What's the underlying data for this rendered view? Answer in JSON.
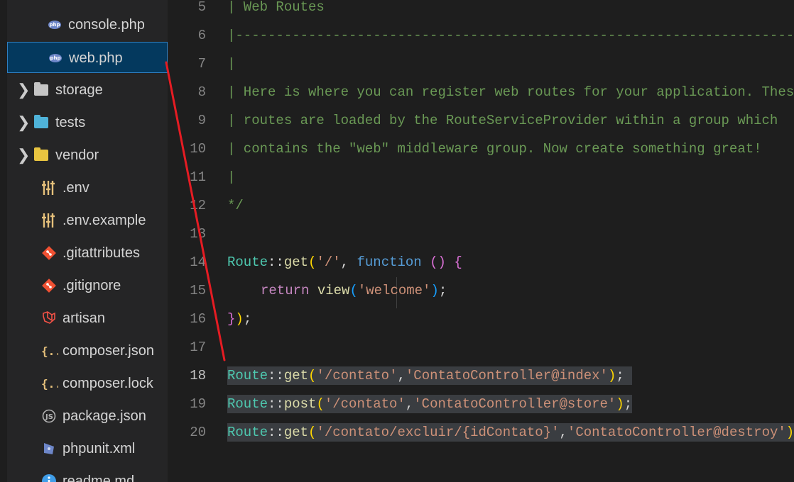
{
  "explorer": {
    "items": [
      {
        "label": "console.php",
        "icon": "php-icon",
        "type": "file"
      },
      {
        "label": "web.php",
        "icon": "php-icon",
        "type": "file",
        "selected": true
      },
      {
        "label": "storage",
        "icon": "folder-icon",
        "type": "folder",
        "chevron": "❯"
      },
      {
        "label": "tests",
        "icon": "folder-tests-icon",
        "type": "folder",
        "chevron": "❯"
      },
      {
        "label": "vendor",
        "icon": "folder-vendor-icon",
        "type": "folder",
        "chevron": "❯"
      },
      {
        "label": ".env",
        "icon": "settings-sliders-icon",
        "type": "file"
      },
      {
        "label": ".env.example",
        "icon": "settings-sliders-icon",
        "type": "file"
      },
      {
        "label": ".gitattributes",
        "icon": "git-icon",
        "type": "file"
      },
      {
        "label": ".gitignore",
        "icon": "git-icon",
        "type": "file"
      },
      {
        "label": "artisan",
        "icon": "laravel-icon",
        "type": "file"
      },
      {
        "label": "composer.json",
        "icon": "json-braces-icon",
        "type": "file"
      },
      {
        "label": "composer.lock",
        "icon": "json-braces-icon",
        "type": "file"
      },
      {
        "label": "package.json",
        "icon": "node-js-icon",
        "type": "file"
      },
      {
        "label": "phpunit.xml",
        "icon": "phpunit-icon",
        "type": "file"
      },
      {
        "label": "readme.md",
        "icon": "info-icon",
        "type": "file"
      }
    ]
  },
  "editor": {
    "line_numbers": [
      "5",
      "6",
      "7",
      "8",
      "9",
      "10",
      "11",
      "12",
      "13",
      "14",
      "15",
      "16",
      "17",
      "18",
      "19",
      "20"
    ],
    "active_line": "18",
    "lines": {
      "l5": "| Web Routes",
      "l6": "|--------------------------------------------------------------------------",
      "l7": "|",
      "l8": "| Here is where you can register web routes for your application. These",
      "l9": "| routes are loaded by the RouteServiceProvider within a group which",
      "l10": "| contains the \"web\" middleware group. Now create something great!",
      "l11": "|",
      "l12": "*/",
      "l14": {
        "cls": "Route",
        "sep": "::",
        "fn": "get",
        "lp": "(",
        "str": "'/'",
        "comma": ", ",
        "kw": "function",
        "sp": " ",
        "lp2": "(",
        "rp2": ")",
        "sp2": " ",
        "lb": "{"
      },
      "l15": {
        "kw": "return",
        "sp": " ",
        "fn": "view",
        "lp": "(",
        "str": "'welcome'",
        "rp": ")",
        "semi": ";"
      },
      "l16": {
        "rb": "}",
        "rp": ")",
        "semi": ";"
      },
      "l18": {
        "cls": "Route",
        "sep": "::",
        "fn": "get",
        "lp": "(",
        "str1": "'/contato'",
        "comma": ",",
        "str2": "'ContatoController@index'",
        "rp": ")",
        "semi": ";"
      },
      "l19": {
        "cls": "Route",
        "sep": "::",
        "fn": "post",
        "lp": "(",
        "str1": "'/contato'",
        "comma": ",",
        "str2": "'ContatoController@store'",
        "rp": ")",
        "semi": ";"
      },
      "l20": {
        "cls": "Route",
        "sep": "::",
        "fn": "get",
        "lp": "(",
        "str1": "'/contato/excluir/{idContato}'",
        "comma": ",",
        "str2": "'ContatoController@destroy'",
        "rp": ")",
        "semi": ";"
      }
    }
  },
  "colors": {
    "annotation_line": "#e51c23",
    "comment": "#6a9955",
    "string": "#ce9178",
    "function": "#dcdcaa",
    "keyword": "#569cd6",
    "class": "#4ec9b0",
    "selection": "#3a3d41"
  }
}
